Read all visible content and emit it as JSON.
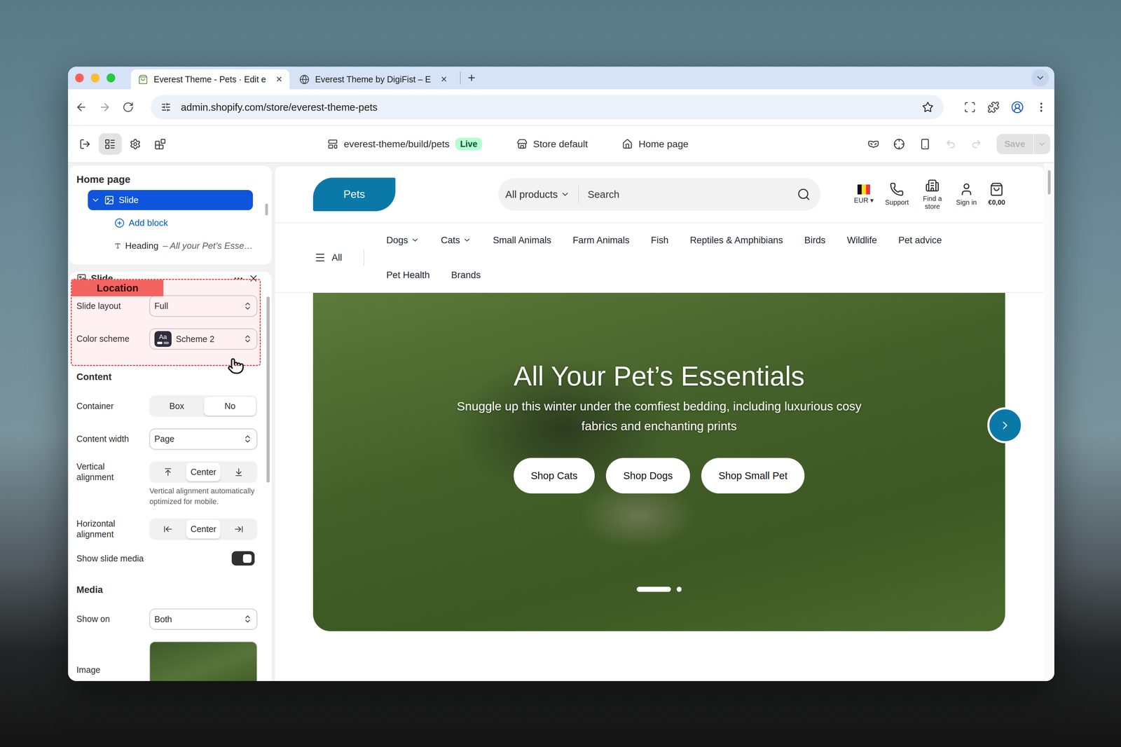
{
  "browser": {
    "tabs": [
      {
        "label": "Everest Theme - Pets · Edit e",
        "close": "×",
        "selected": true
      },
      {
        "label": "Everest Theme by DigiFist – E",
        "close": "×",
        "selected": false
      }
    ],
    "new_tab": "+",
    "address": "admin.shopify.com/store/everest-theme-pets"
  },
  "editor": {
    "tools": [
      {
        "kind": "exit",
        "selected": false
      },
      {
        "kind": "sections",
        "selected": true
      },
      {
        "kind": "settings",
        "selected": false
      },
      {
        "kind": "apps",
        "selected": false
      }
    ],
    "theme": "everest-theme/build/pets",
    "status": "Live",
    "store": "Store default",
    "page": "Home page",
    "undo_disabled": true,
    "redo_disabled": true,
    "save": {
      "label": "Save",
      "disabled": true
    }
  },
  "sidebar": {
    "title": "Home page",
    "tree": [
      {
        "kind": "block",
        "label": "Slide",
        "detail": "",
        "selected": true,
        "expanded": true
      },
      {
        "kind": "add",
        "label": "Add block",
        "detail": "",
        "selected": false,
        "expanded": false
      },
      {
        "kind": "text",
        "label": "Heading",
        "detail": "– All your Pet’s Esse…",
        "selected": false,
        "expanded": false
      }
    ]
  },
  "settings": {
    "title": "Slide",
    "annotation": "Location",
    "fields": [
      {
        "kind": "select",
        "label": "Slide layout",
        "value": "Full"
      },
      {
        "kind": "scheme",
        "label": "Color scheme",
        "value": "Scheme 2",
        "swatch": "Aa"
      },
      {
        "kind": "heading",
        "label": "Content"
      },
      {
        "kind": "segmented",
        "label": "Container",
        "options": [
          {
            "kind": "text",
            "label": "Box",
            "selected": false
          },
          {
            "kind": "text",
            "label": "No",
            "selected": true
          }
        ]
      },
      {
        "kind": "select",
        "label": "Content width",
        "value": "Page"
      },
      {
        "kind": "align-v",
        "label": "Vertical alignment",
        "options": [
          {
            "kind": "start",
            "selected": false
          },
          {
            "kind": "center",
            "label": "Center",
            "selected": true
          },
          {
            "kind": "end",
            "selected": false
          }
        ],
        "help": "Vertical alignment automatically optimized for mobile."
      },
      {
        "kind": "align-h",
        "label": "Horizontal alignment",
        "options": [
          {
            "kind": "start",
            "selected": false
          },
          {
            "kind": "center",
            "label": "Center",
            "selected": true
          },
          {
            "kind": "end",
            "selected": false
          }
        ]
      },
      {
        "kind": "toggle",
        "label": "Show slide media",
        "on": true
      },
      {
        "kind": "divider"
      },
      {
        "kind": "heading",
        "label": "Media"
      },
      {
        "kind": "select",
        "label": "Show on",
        "value": "Both"
      },
      {
        "kind": "image",
        "label": "Image"
      }
    ]
  },
  "store": {
    "logo": "Pets",
    "search": {
      "category": "All products",
      "placeholder": "Search"
    },
    "actions": [
      {
        "kind": "flag",
        "label": "EUR ▾"
      },
      {
        "kind": "phone",
        "label": "Support"
      },
      {
        "kind": "store",
        "label": "Find a store"
      },
      {
        "kind": "user",
        "label": "Sign in"
      },
      {
        "kind": "cart",
        "label": "€0,00"
      }
    ],
    "nav": {
      "all": "All",
      "rows": [
        [
          {
            "label": "Dogs",
            "dropdown": true
          },
          {
            "label": "Cats",
            "dropdown": true
          },
          {
            "label": "Small Animals",
            "dropdown": false
          },
          {
            "label": "Farm Animals",
            "dropdown": false
          },
          {
            "label": "Fish",
            "dropdown": false
          },
          {
            "label": "Reptiles & Amphibians",
            "dropdown": false
          },
          {
            "label": "Birds",
            "dropdown": false
          },
          {
            "label": "Wildlife",
            "dropdown": false
          },
          {
            "label": "Pet advice",
            "dropdown": false
          }
        ],
        [
          {
            "label": "Pet Health",
            "dropdown": false
          },
          {
            "label": "Brands",
            "dropdown": false
          }
        ]
      ]
    },
    "hero": {
      "heading": "All Your Pet’s Essentials",
      "text": "Snuggle up this winter under the comfiest bedding, including luxurious cosy fabrics and enchanting prints",
      "buttons": [
        "Shop Cats",
        "Shop Dogs",
        "Shop Small Pet"
      ],
      "slides": [
        {
          "selected": true
        },
        {
          "selected": false
        }
      ]
    }
  }
}
